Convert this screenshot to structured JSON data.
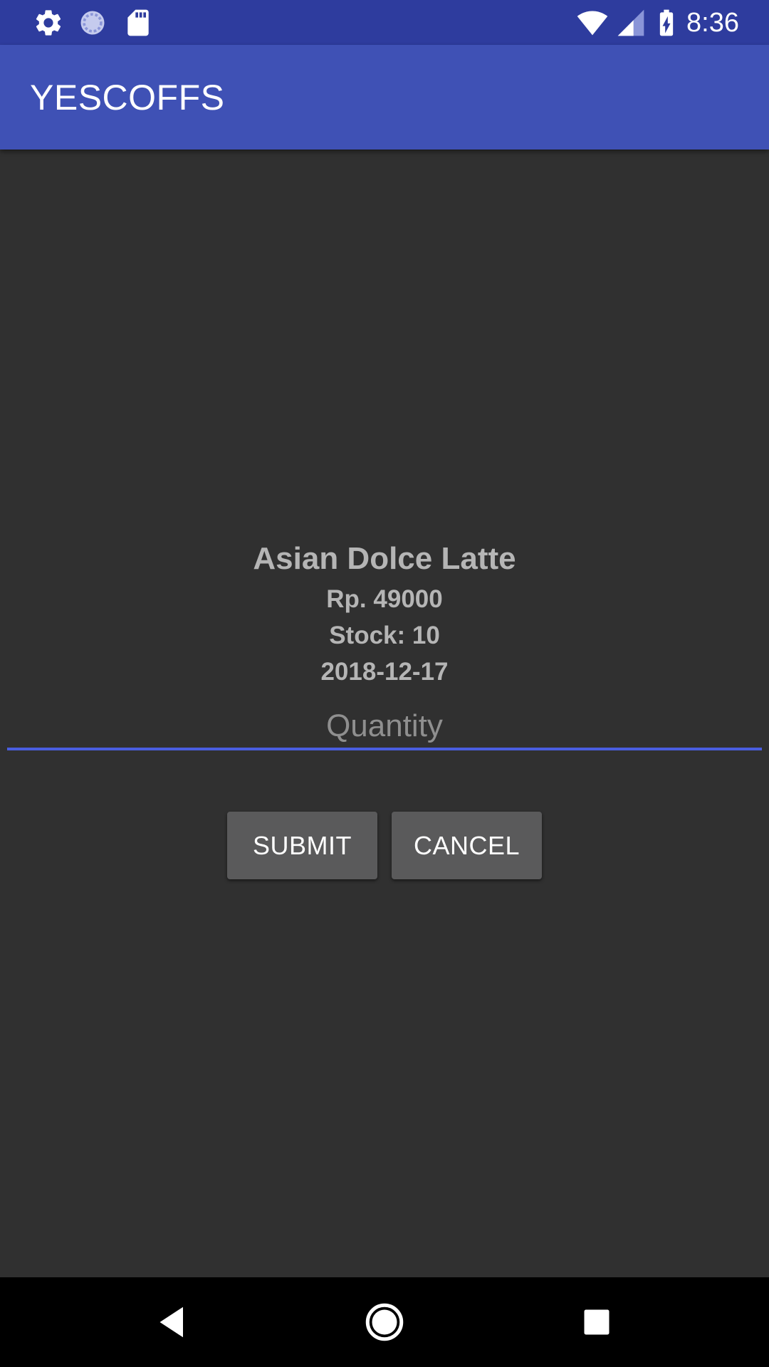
{
  "status_bar": {
    "time": "8:36",
    "icons": [
      "gear-icon",
      "sync-icon",
      "sd-card-icon",
      "wifi-icon",
      "cell-signal-icon",
      "battery-charging-icon"
    ]
  },
  "app_bar": {
    "title": "YESCOFFS"
  },
  "product": {
    "name": "Asian Dolce Latte",
    "price": "Rp. 49000",
    "stock": "Stock: 10",
    "date": "2018-12-17"
  },
  "quantity_field": {
    "value": "",
    "placeholder": "Quantity"
  },
  "actions": {
    "submit_label": "SUBMIT",
    "cancel_label": "CANCEL"
  },
  "nav_bar": {
    "icons": [
      "back-icon",
      "home-icon",
      "recents-icon"
    ]
  },
  "colors": {
    "status_bar": "#2e3c9e",
    "app_bar": "#3f51b5",
    "background": "#303030",
    "accent": "#4a5ee0",
    "button": "#5a5a5b"
  }
}
